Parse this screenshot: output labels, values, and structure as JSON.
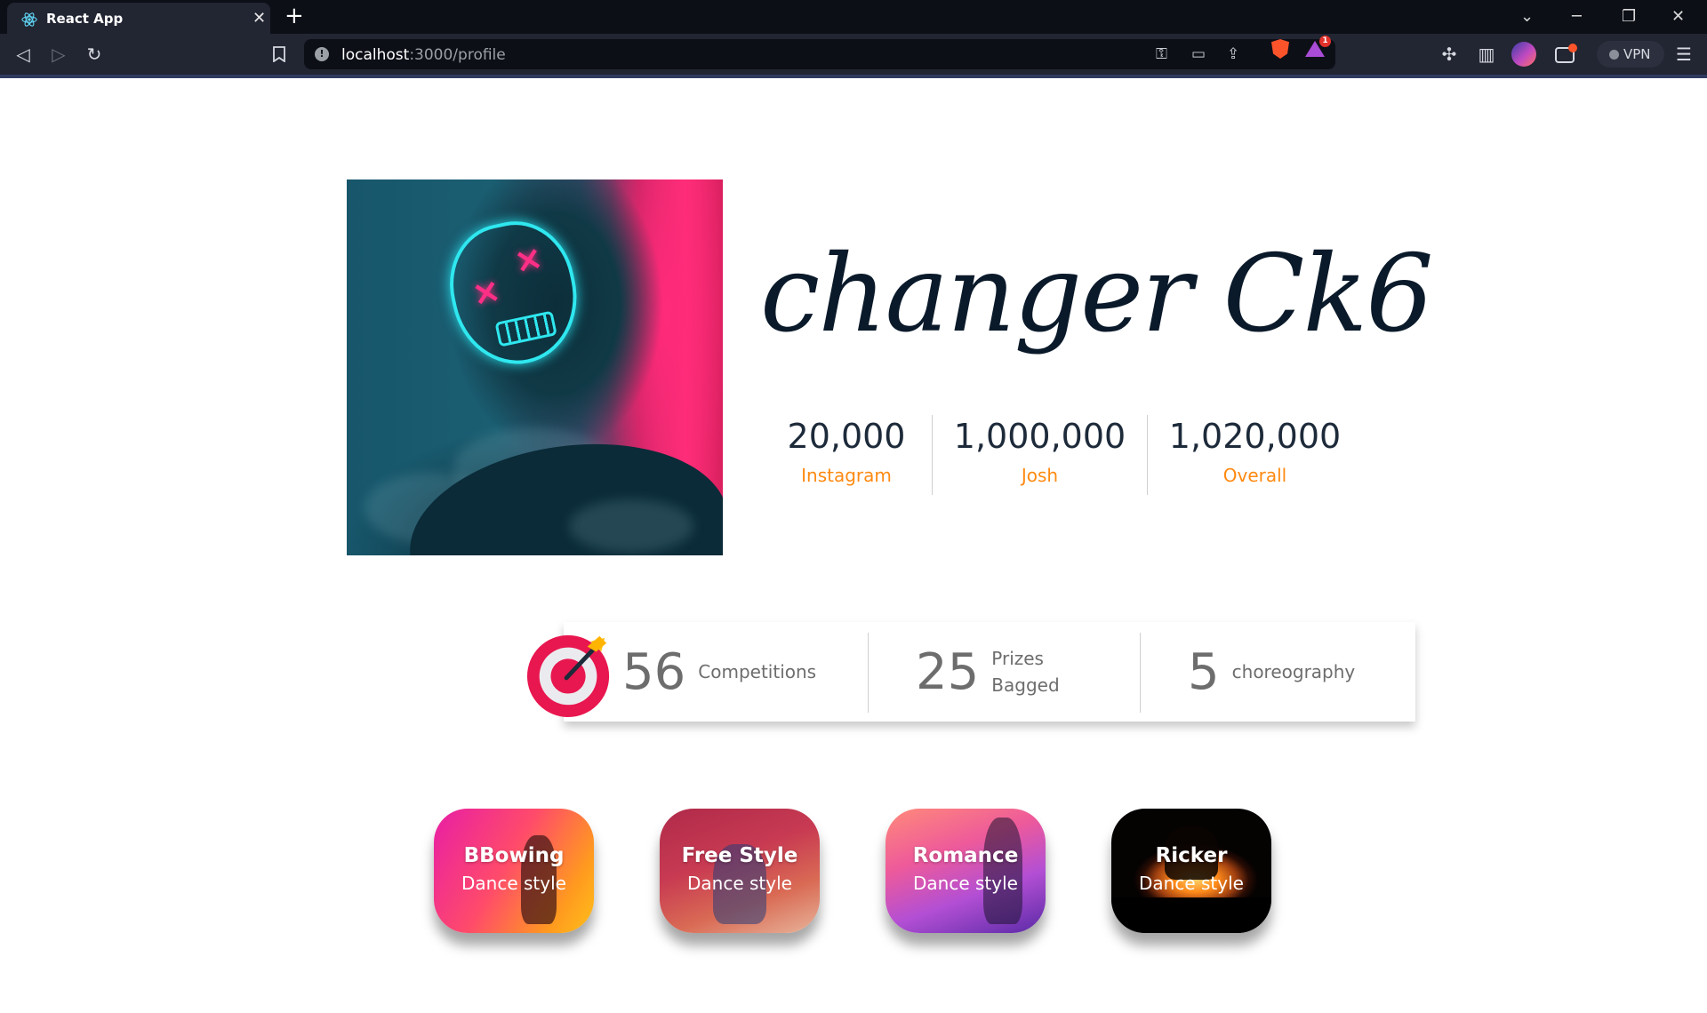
{
  "browser": {
    "tab_title": "React App",
    "tab_close": "✕",
    "new_tab": "+",
    "url_host": "localhost",
    "url_path": ":3000/profile",
    "vpn_label": "VPN",
    "notification_count": "1"
  },
  "profile": {
    "name": "changer Ck6",
    "stats": [
      {
        "value": "20,000",
        "label": "Instagram"
      },
      {
        "value": "1,000,000",
        "label": "Josh"
      },
      {
        "value": "1,020,000",
        "label": "Overall"
      }
    ]
  },
  "achievements": [
    {
      "number": "56",
      "label_line1": "Competitions",
      "label_line2": ""
    },
    {
      "number": "25",
      "label_line1": "Prizes",
      "label_line2": "Bagged"
    },
    {
      "number": "5",
      "label_line1": "choreography",
      "label_line2": ""
    }
  ],
  "dance_styles": [
    {
      "title": "BBowing",
      "subtitle": "Dance style"
    },
    {
      "title": "Free Style",
      "subtitle": "Dance style"
    },
    {
      "title": "Romance",
      "subtitle": "Dance style"
    },
    {
      "title": "Ricker",
      "subtitle": "Dance style"
    }
  ],
  "colors": {
    "accent": "#ff8a12",
    "name_text": "#0b1a2a",
    "stat_text": "#1d2a3a",
    "muted_text": "#6d6d6d",
    "target_red": "#e8174f",
    "browser_bg": "#0d0f17",
    "toolbar_bg": "#222532"
  },
  "icons": {
    "tab": "react-icon",
    "back": "back-arrow-icon",
    "forward": "forward-arrow-icon",
    "reload": "reload-icon",
    "bookmark": "bookmark-icon",
    "site_info": "info-icon",
    "key": "key-icon",
    "cast": "cast-icon",
    "share": "share-icon",
    "brave": "brave-lion-icon",
    "rewards": "brave-rewards-icon",
    "extensions": "puzzle-icon",
    "sidebar": "sidebar-icon",
    "wallet": "wallet-icon",
    "menu": "hamburger-icon",
    "target": "target-arrow-icon"
  }
}
